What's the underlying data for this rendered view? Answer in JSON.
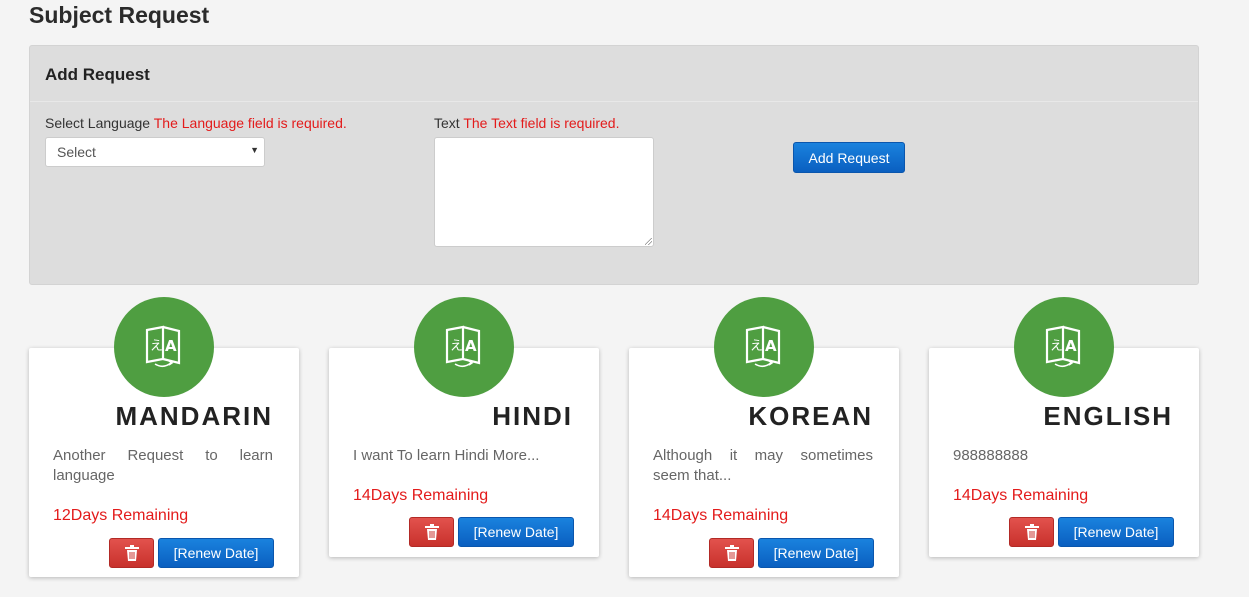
{
  "page": {
    "title": "Subject Request"
  },
  "form": {
    "heading": "Add Request",
    "language_label": "Select Language",
    "language_error": "The Language field is required.",
    "language_value": "Select",
    "text_label": "Text",
    "text_error": "The Text field is required.",
    "text_value": "",
    "submit_label": "Add Request"
  },
  "colors": {
    "accent_green": "#4f9e41",
    "error_red": "#e31b1b",
    "primary_blue": "#0a5fc0",
    "danger_red": "#d9534f"
  },
  "icons": {
    "language": "translate-icon",
    "delete": "trash-icon"
  },
  "cards": [
    {
      "language": "MANDARIN",
      "description": "Another Request to learn language",
      "remaining": "12Days Remaining",
      "renew_label": "[Renew Date]"
    },
    {
      "language": "HINDI",
      "description": "I want To learn Hindi More...",
      "remaining": "14Days Remaining",
      "renew_label": "[Renew Date]"
    },
    {
      "language": "KOREAN",
      "description": "Although it may sometimes seem that...",
      "remaining": "14Days Remaining",
      "renew_label": "[Renew Date]"
    },
    {
      "language": "ENGLISH",
      "description": "988888888",
      "remaining": "14Days Remaining",
      "renew_label": "[Renew Date]"
    }
  ]
}
